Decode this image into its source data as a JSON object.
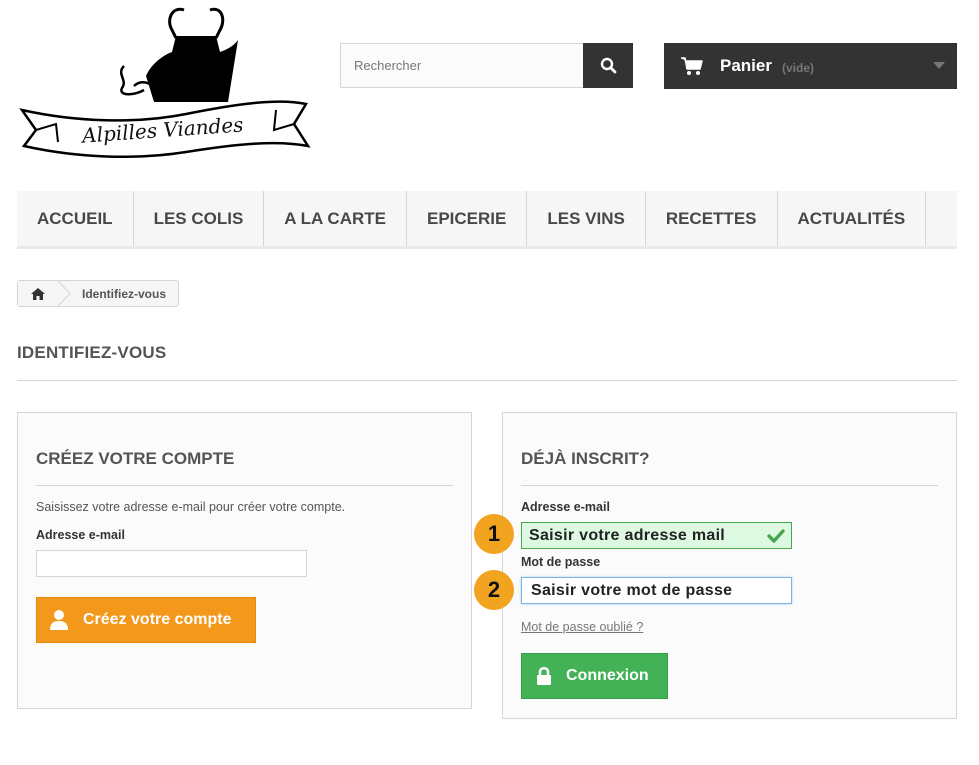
{
  "logo": {
    "text": "Alpilles Viandes"
  },
  "search": {
    "placeholder": "Rechercher"
  },
  "cart": {
    "title": "Panier",
    "status": "(vide)"
  },
  "menu": [
    "ACCUEIL",
    "LES COLIS",
    "A LA CARTE",
    "EPICERIE",
    "LES VINS",
    "RECETTES",
    "ACTUALITÉS"
  ],
  "breadcrumb": {
    "current": "Identifiez-vous"
  },
  "page": {
    "heading": "IDENTIFIEZ-VOUS"
  },
  "create": {
    "title": "CRÉEZ VOTRE COMPTE",
    "hint": "Saisissez votre adresse e-mail pour créer votre compte.",
    "email_label": "Adresse e-mail",
    "email_value": "",
    "button": "Créez votre compte"
  },
  "login": {
    "title": "DÉJÀ INSCRIT?",
    "email_label": "Adresse e-mail",
    "email_value": "Saisir votre adresse mail",
    "password_label": "Mot de passe",
    "password_value": "Saisir votre mot de passe",
    "forgot": "Mot de passe oublié ?",
    "button": "Connexion"
  },
  "annotations": [
    "1",
    "2"
  ],
  "colors": {
    "orange": "#f3981b",
    "green": "#43b155",
    "dark": "#333333",
    "badge": "#f2a320"
  }
}
